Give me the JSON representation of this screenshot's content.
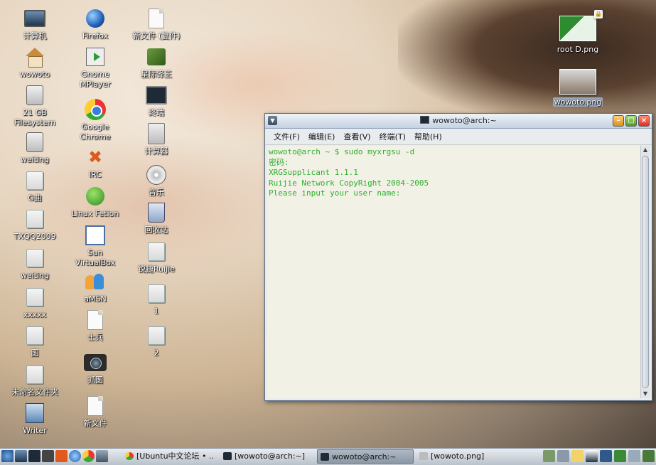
{
  "desktop": {
    "col1": [
      {
        "label": "计算机",
        "icon": "computer-icon"
      },
      {
        "label": "wowoto",
        "icon": "home-folder-icon"
      },
      {
        "label": "21 GB\nFilesystem",
        "icon": "disk-icon"
      },
      {
        "label": "weiting",
        "icon": "disk-icon"
      },
      {
        "label": "G曲",
        "icon": "folder-icon"
      },
      {
        "label": "TXQQ2009",
        "icon": "folder-icon"
      },
      {
        "label": "weiting",
        "icon": "folder-icon"
      },
      {
        "label": "xxxxx",
        "icon": "folder-icon"
      },
      {
        "label": "图",
        "icon": "folder-icon"
      },
      {
        "label": "未命名文件夹",
        "icon": "folder-icon"
      },
      {
        "label": "Writer",
        "icon": "writer-icon"
      }
    ],
    "col2": [
      {
        "label": "Firefox",
        "icon": "firefox-icon"
      },
      {
        "label": "Gnome\nMPlayer",
        "icon": "mplayer-icon"
      },
      {
        "label": "Google\nChrome",
        "icon": "chrome-icon"
      },
      {
        "label": "IRC",
        "icon": "irc-icon"
      },
      {
        "label": "Linux Fetion",
        "icon": "fetion-icon"
      },
      {
        "label": "Sun\nVirtualBox",
        "icon": "virtualbox-icon"
      },
      {
        "label": "aMSN",
        "icon": "amsn-icon"
      },
      {
        "label": "士兵",
        "icon": "document-icon"
      },
      {
        "label": "抓图",
        "icon": "camera-icon"
      },
      {
        "label": "新文件",
        "icon": "document-icon"
      }
    ],
    "col3": [
      {
        "label": "新文件 (复件)",
        "icon": "document-icon"
      },
      {
        "label": "星际译王",
        "icon": "dictionary-icon"
      },
      {
        "label": "终端",
        "icon": "terminal-icon"
      },
      {
        "label": "计算器",
        "icon": "calculator-icon"
      },
      {
        "label": "音乐",
        "icon": "music-icon"
      },
      {
        "label": "回收站",
        "icon": "trash-icon"
      },
      {
        "label": "锐捷Ruijie",
        "icon": "folder-icon"
      },
      {
        "label": "1",
        "icon": "folder-icon"
      },
      {
        "label": "2",
        "icon": "folder-icon"
      }
    ],
    "files": [
      {
        "label": "root D.png"
      },
      {
        "label": "wowoto.png"
      }
    ]
  },
  "window": {
    "title": "wowoto@arch:~",
    "menu": [
      "文件(F)",
      "编辑(E)",
      "查看(V)",
      "终端(T)",
      "帮助(H)"
    ],
    "terminal_lines": [
      "wowoto@arch ~ $ sudo myxrgsu -d",
      "密码:",
      "XRGSupplicant 1.1.1",
      "Ruijie Network CopyRight 2004-2005",
      "Please input your user name:"
    ]
  },
  "taskbar": {
    "tasks": [
      {
        "label": "[Ubuntu中文论坛 • ...",
        "active": false
      },
      {
        "label": "[wowoto@arch:~]",
        "active": false
      },
      {
        "label": "wowoto@arch:~",
        "active": true
      },
      {
        "label": "[wowoto.png]",
        "active": false
      }
    ]
  },
  "colors": {
    "terminal_text": "#2fae2f",
    "terminal_bg": "#f2f1e6"
  }
}
